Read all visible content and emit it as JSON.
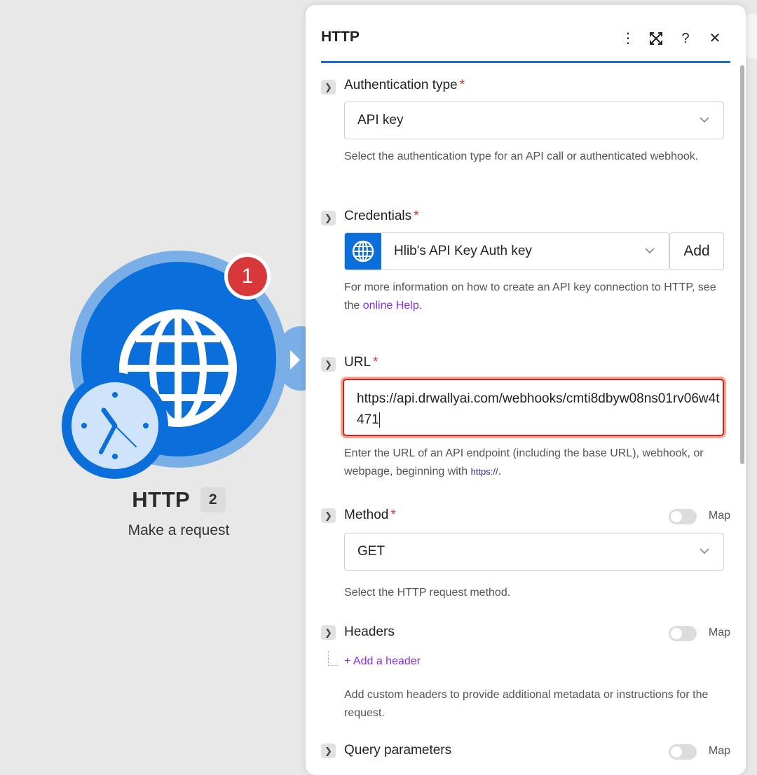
{
  "module": {
    "name": "HTTP",
    "id_badge": "2",
    "subtitle": "Make a request",
    "error_count": "1",
    "icon": "globe-icon",
    "secondary_icon": "clock-icon"
  },
  "panel": {
    "title": "HTTP",
    "header_icons": [
      "more-vertical-icon",
      "expand-icon",
      "help-icon",
      "close-icon"
    ],
    "more_glyph": "⋮",
    "help_glyph": "?",
    "close_glyph": "✕",
    "accent_color": "#1b6ed8"
  },
  "fields": {
    "auth": {
      "label": "Authentication type",
      "required": "*",
      "value": "API key",
      "help": "Select the authentication type for an API call or authenticated webhook."
    },
    "credentials": {
      "label": "Credentials",
      "required": "*",
      "value": "Hlib's API Key Auth key",
      "add_label": "Add",
      "help_prefix": "For more information on how to create an API key connection to HTTP, see the ",
      "help_link": "online Help",
      "help_suffix": "."
    },
    "url": {
      "label": "URL",
      "required": "*",
      "value": "https://api.drwallyai.com/webhooks/cmti8dbyw08ns01rv06w4t471",
      "help_prefix": "Enter the URL of an API endpoint (including the base URL), webhook, or webpage, beginning with ",
      "help_code": "https://",
      "help_suffix": "."
    },
    "method": {
      "label": "Method",
      "required": "*",
      "value": "GET",
      "map_label": "Map",
      "help": "Select the HTTP request method."
    },
    "headers": {
      "label": "Headers",
      "map_label": "Map",
      "add_label": "+ Add a header",
      "help": "Add custom headers to provide additional metadata or instructions for the request."
    },
    "query": {
      "label": "Query parameters",
      "map_label": "Map"
    }
  }
}
